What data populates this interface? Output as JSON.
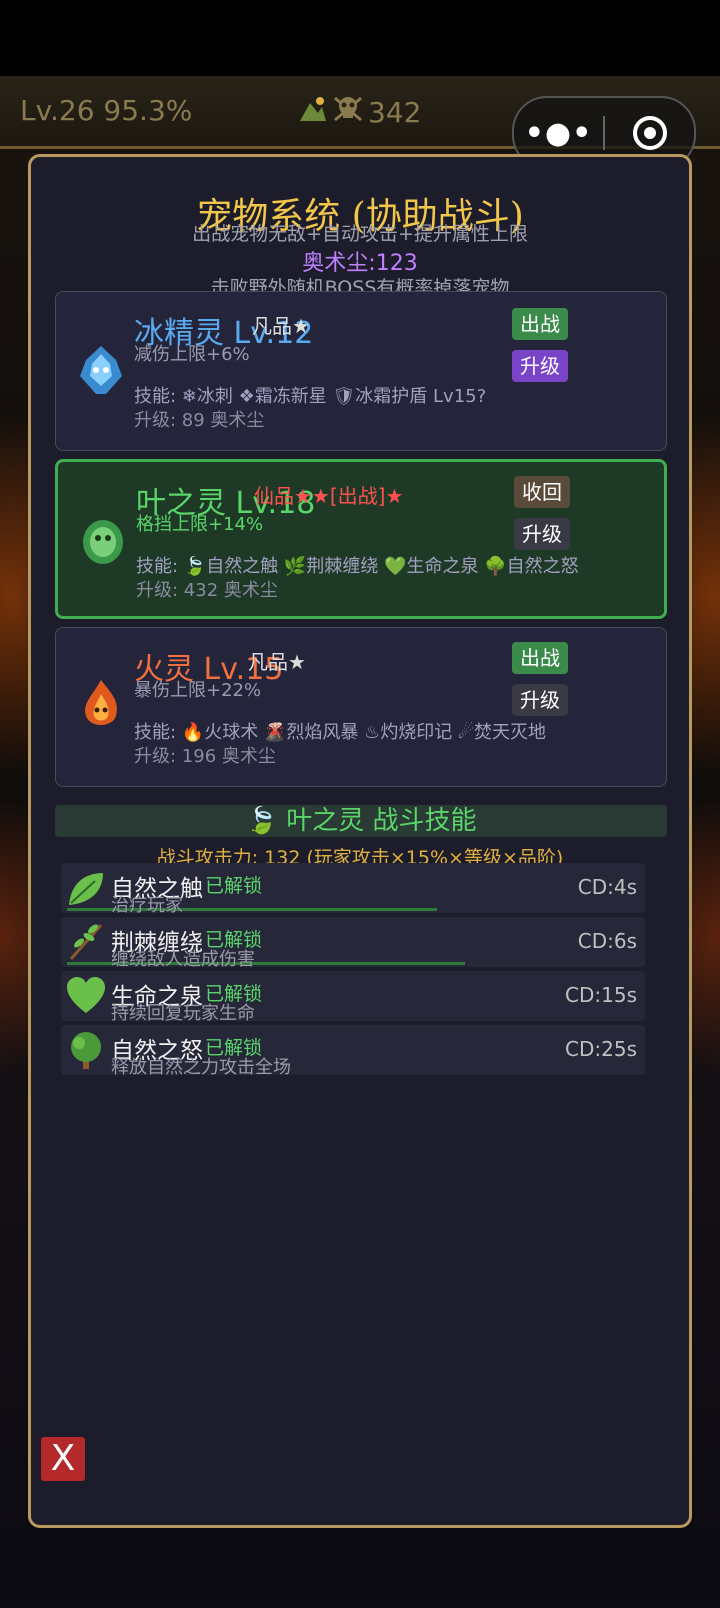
{
  "hud": {
    "level": "Lv.26 95.3%",
    "resource": "342"
  },
  "panel": {
    "title": "宠物系统 (协助战斗)",
    "subtitle": "出战宠物无敌+自动攻击+提升属性上限",
    "dust": "奥术尘:123",
    "drop_note": "击败野外随机BOSS有概率掉落宠物"
  },
  "pets": [
    {
      "name": "冰精灵 Lv.12",
      "rank": "凡品★",
      "bonus": "减伤上限+6%",
      "skills": "技能: ❄冰刺 ❖霜冻新星 🛡冰霜护盾 Lv15?",
      "cost": "升级: 89 奥术尘",
      "btn1": "出战",
      "btn2": "升级",
      "name_color": "#5aaaf0"
    },
    {
      "name": "叶之灵 Lv.18",
      "rank": "仙品★★[出战]★",
      "bonus": "格挡上限+14%",
      "skills": "技能: 🍃自然之触 🌿荆棘缠绕 💚生命之泉 🌳自然之怒",
      "cost": "升级: 432 奥术尘",
      "btn1": "收回",
      "btn2": "升级",
      "name_color": "#5ad56a"
    },
    {
      "name": "火灵 Lv.15",
      "rank": "凡品★",
      "bonus": "暴伤上限+22%",
      "skills": "技能: 🔥火球术 🌋烈焰风暴 ♨灼烧印记 ☄焚天灭地",
      "cost": "升级: 196 奥术尘",
      "btn1": "出战",
      "btn2": "升级",
      "name_color": "#f07040"
    }
  ],
  "skill_section": {
    "header": "叶之灵 战斗技能",
    "attack": "战斗攻击力: 132 (玩家攻击×15%×等级×品阶)",
    "skills": [
      {
        "name": "自然之触",
        "unlock": "已解锁",
        "desc": "治疗玩家",
        "cd": "CD:4s",
        "progress": 0.66,
        "icon": "leaf-icon"
      },
      {
        "name": "荆棘缠绕",
        "unlock": "已解锁",
        "desc": "缠绕敌人造成伤害",
        "cd": "CD:6s",
        "progress": 0.71,
        "icon": "herb-icon"
      },
      {
        "name": "生命之泉",
        "unlock": "已解锁",
        "desc": "持续回复玩家生命",
        "cd": "CD:15s",
        "progress": 0.0,
        "icon": "heart-icon"
      },
      {
        "name": "自然之怒",
        "unlock": "已解锁",
        "desc": "释放自然之力攻击全场",
        "cd": "CD:25s",
        "progress": 0.0,
        "icon": "tree-icon"
      }
    ]
  },
  "close_label": "X"
}
